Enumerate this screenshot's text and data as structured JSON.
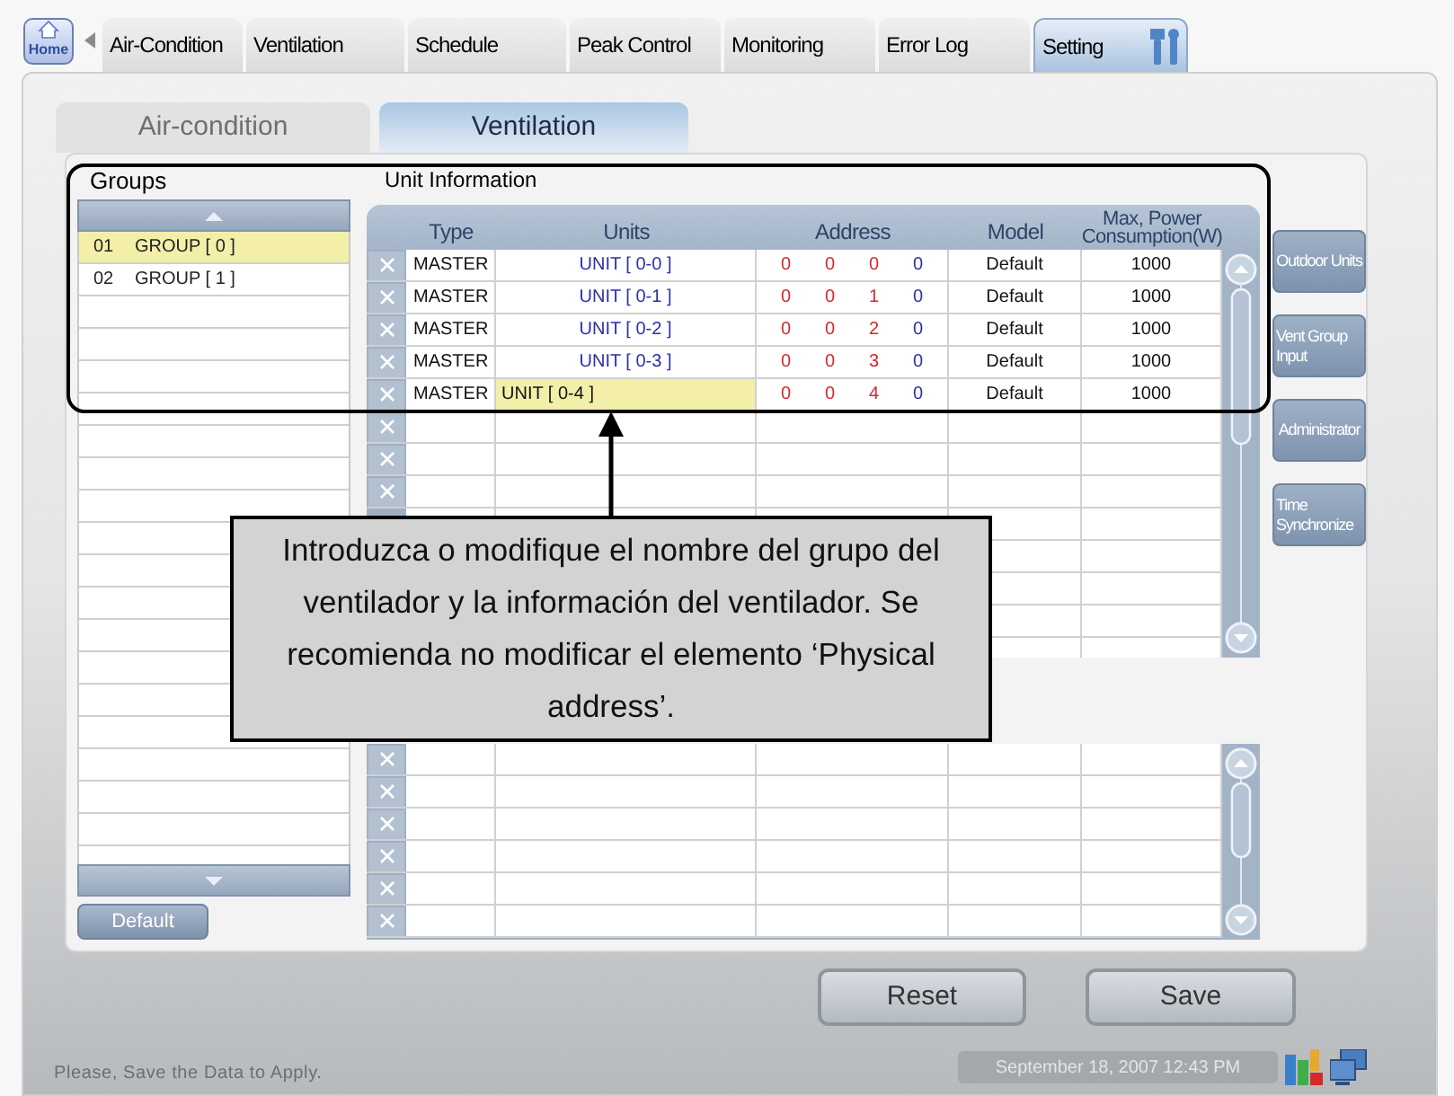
{
  "nav_tabs": [
    {
      "label": "Home",
      "kind": "home",
      "selected": false
    },
    {
      "label": "Air-Condition",
      "kind": "tab",
      "selected": false
    },
    {
      "label": "Ventilation",
      "kind": "tab",
      "selected": false
    },
    {
      "label": "Schedule",
      "kind": "tab",
      "selected": false
    },
    {
      "label": "Peak Control",
      "kind": "tab",
      "selected": false
    },
    {
      "label": "Monitoring",
      "kind": "tab",
      "selected": false
    },
    {
      "label": "Error Log",
      "kind": "tab",
      "selected": false
    },
    {
      "label": "Setting",
      "kind": "tab",
      "selected": true
    }
  ],
  "sub_tabs": [
    {
      "label": "Air-condition",
      "selected": false
    },
    {
      "label": "Ventilation",
      "selected": true
    }
  ],
  "groups": {
    "title": "Groups",
    "items": [
      {
        "number": "01",
        "name": "GROUP [ 0 ]",
        "selected": true
      },
      {
        "number": "02",
        "name": "GROUP [ 1 ]",
        "selected": false
      }
    ],
    "default_button": "Default"
  },
  "unit_information": {
    "title": "Unit Information",
    "columns": [
      "Type",
      "Units",
      "Address",
      "Model",
      "Max, Power Consumption(W)"
    ],
    "rows": [
      {
        "type": "MASTER",
        "unit": "UNIT [ 0-0 ]",
        "address": [
          "0",
          "0",
          "0",
          "0"
        ],
        "model": "Default",
        "max_power": "1000",
        "selected": false
      },
      {
        "type": "MASTER",
        "unit": "UNIT [ 0-1 ]",
        "address": [
          "0",
          "0",
          "1",
          "0"
        ],
        "model": "Default",
        "max_power": "1000",
        "selected": false
      },
      {
        "type": "MASTER",
        "unit": "UNIT [ 0-2 ]",
        "address": [
          "0",
          "0",
          "2",
          "0"
        ],
        "model": "Default",
        "max_power": "1000",
        "selected": false
      },
      {
        "type": "MASTER",
        "unit": "UNIT [ 0-3 ]",
        "address": [
          "0",
          "0",
          "3",
          "0"
        ],
        "model": "Default",
        "max_power": "1000",
        "selected": false
      },
      {
        "type": "MASTER",
        "unit": "UNIT [ 0-4 ]",
        "address": [
          "0",
          "0",
          "4",
          "0"
        ],
        "model": "Default",
        "max_power": "1000",
        "selected": true
      }
    ]
  },
  "side_buttons": [
    "Outdoor Units",
    "Vent Group Input",
    "Administrator",
    "Time Synchronize"
  ],
  "callout": "Introduzca o modifique el nombre del grupo del ventilador y la información del ventilador. Se recomienda no modificar el elemento ‘Physical address’.",
  "actions": [
    "Reset",
    "Save"
  ],
  "status_bar": {
    "message": "Please, Save the Data to Apply.",
    "datetime": "September 18, 2007 12:43 PM"
  }
}
